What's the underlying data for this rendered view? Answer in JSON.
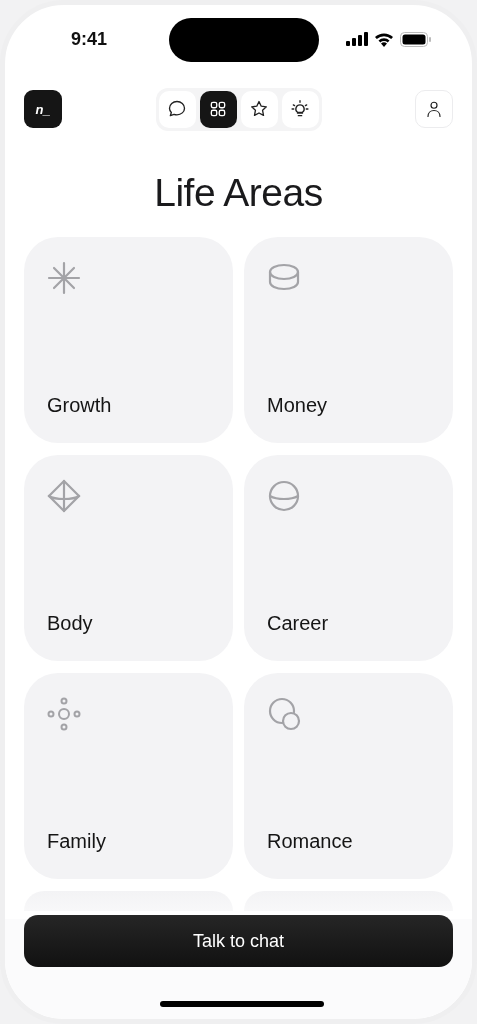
{
  "status_bar": {
    "time": "9:41"
  },
  "header": {
    "logo": "n_",
    "nav_tabs": [
      {
        "selected": false
      },
      {
        "selected": true
      },
      {
        "selected": false
      },
      {
        "selected": false
      }
    ]
  },
  "title": "Life Areas",
  "areas": [
    {
      "kind": "full",
      "label": "Growth"
    },
    {
      "kind": "full",
      "label": "Money"
    },
    {
      "kind": "full",
      "label": "Body"
    },
    {
      "kind": "full",
      "label": "Career"
    },
    {
      "kind": "full",
      "label": "Family"
    },
    {
      "kind": "full",
      "label": "Romance"
    },
    {
      "kind": "partial"
    },
    {
      "kind": "partial"
    }
  ],
  "action_button": "Talk to chat"
}
